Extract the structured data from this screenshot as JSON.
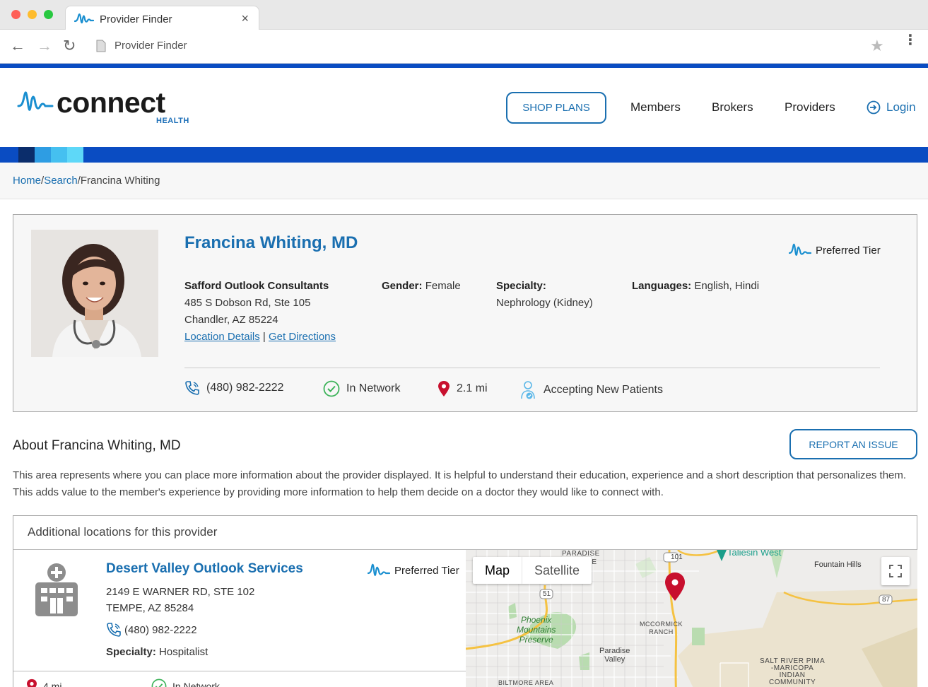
{
  "browser": {
    "tab_title": "Provider Finder",
    "tab_close": "×",
    "url": "Provider Finder",
    "back": "←",
    "forward": "→",
    "reload": "↻",
    "star": "★",
    "menu": "⋮"
  },
  "colors": {
    "brand_blue": "#0a4cc2",
    "link_blue": "#1a6fb0",
    "pin_red": "#c8102e",
    "check_green": "#3db35a"
  },
  "header": {
    "logo_text": "connect",
    "logo_sub": "HEALTH",
    "shop_plans": "SHOP PLANS",
    "nav": [
      "Members",
      "Brokers",
      "Providers"
    ],
    "login": "Login"
  },
  "breadcrumb": {
    "home": "Home",
    "search": "Search",
    "current": "Francina Whiting",
    "sep": "/"
  },
  "provider": {
    "name": "Francina Whiting, MD",
    "tier": "Preferred Tier",
    "practice": "Safford Outlook Consultants",
    "address1": "485 S Dobson Rd, Ste 105",
    "address2": "Chandler, AZ 85224",
    "location_details": "Location Details",
    "link_sep": "|",
    "get_directions": "Get Directions",
    "gender_label": "Gender:",
    "gender": "Female",
    "specialty_label": "Specialty:",
    "specialty": "Nephrology (Kidney)",
    "languages_label": "Languages:",
    "languages": "English, Hindi",
    "phone": "(480) 982-2222",
    "network": "In Network",
    "distance": "2.1 mi",
    "accepting": "Accepting New Patients"
  },
  "about": {
    "title": "About Francina Whiting, MD",
    "report_button": "REPORT AN ISSUE",
    "text": "This area represents where you can place more information about the provider displayed. It is helpful to understand their education, experience and a short description that personalizes them. This adds value to the member's experience by providing more information to help them decide on a doctor they would like to connect with."
  },
  "additional": {
    "heading": "Additional locations for this provider",
    "location": {
      "name": "Desert Valley Outlook Services",
      "tier": "Preferred Tier",
      "address1": "2149 E WARNER RD, STE 102",
      "address2": "TEMPE, AZ 85284",
      "phone": "(480) 982-2222",
      "specialty_label": "Specialty:",
      "specialty": "Hospitalist",
      "distance": "4 mi",
      "network": "In Network"
    },
    "map": {
      "map_tab": "Map",
      "satellite_tab": "Satellite",
      "labels": {
        "paradise_village": "PARADISE\nVILLAGE",
        "taliesin": "Taliesin West",
        "fountain_hills": "Fountain Hills",
        "phoenix_mountains": "Phoenix\nMountains\nPreserve",
        "mccormick": "MCCORMICK\nRANCH",
        "paradise_valley": "Paradise\nValley",
        "salt_river": "SALT RIVER PIMA\n-MARICOPA\nINDIAN\nCOMMUNITY",
        "biltmore": "BILTMORE AREA",
        "r101": "101",
        "r51": "51",
        "r87": "87"
      }
    }
  }
}
